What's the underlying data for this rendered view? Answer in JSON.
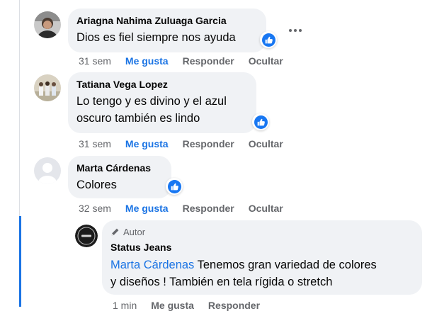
{
  "comments": [
    {
      "author": "Ariagna Nahima Zuluaga Garcia",
      "text": "Dios es fiel siempre nos ayuda",
      "time": "31 sem",
      "like_label": "Me gusta",
      "reply_label": "Responder",
      "hide_label": "Ocultar"
    },
    {
      "author": "Tatiana Vega Lopez",
      "text_line1": "Lo tengo y es divino y el azul",
      "text_line2": "oscuro también es lindo",
      "time": "31 sem",
      "like_label": "Me gusta",
      "reply_label": "Responder",
      "hide_label": "Ocultar"
    },
    {
      "author": "Marta Cárdenas",
      "text": "Colores",
      "time": "32 sem",
      "like_label": "Me gusta",
      "reply_label": "Responder",
      "hide_label": "Ocultar"
    }
  ],
  "reply": {
    "badge": "Autor",
    "author": "Status Jeans",
    "mention": "Marta Cárdenas",
    "text_line1_rest": " Tenemos gran variedad de colores",
    "text_line2": "y diseños ! También en tela rígida o stretch",
    "time": "1 min",
    "like_label": "Me gusta",
    "reply_label": "Responder"
  },
  "colors": {
    "accent": "#1b74e4",
    "bubble": "#f0f2f5",
    "secondary_text": "#65676b"
  },
  "icons": [
    "more-options-icon",
    "like-reaction-icon",
    "pencil-icon"
  ]
}
